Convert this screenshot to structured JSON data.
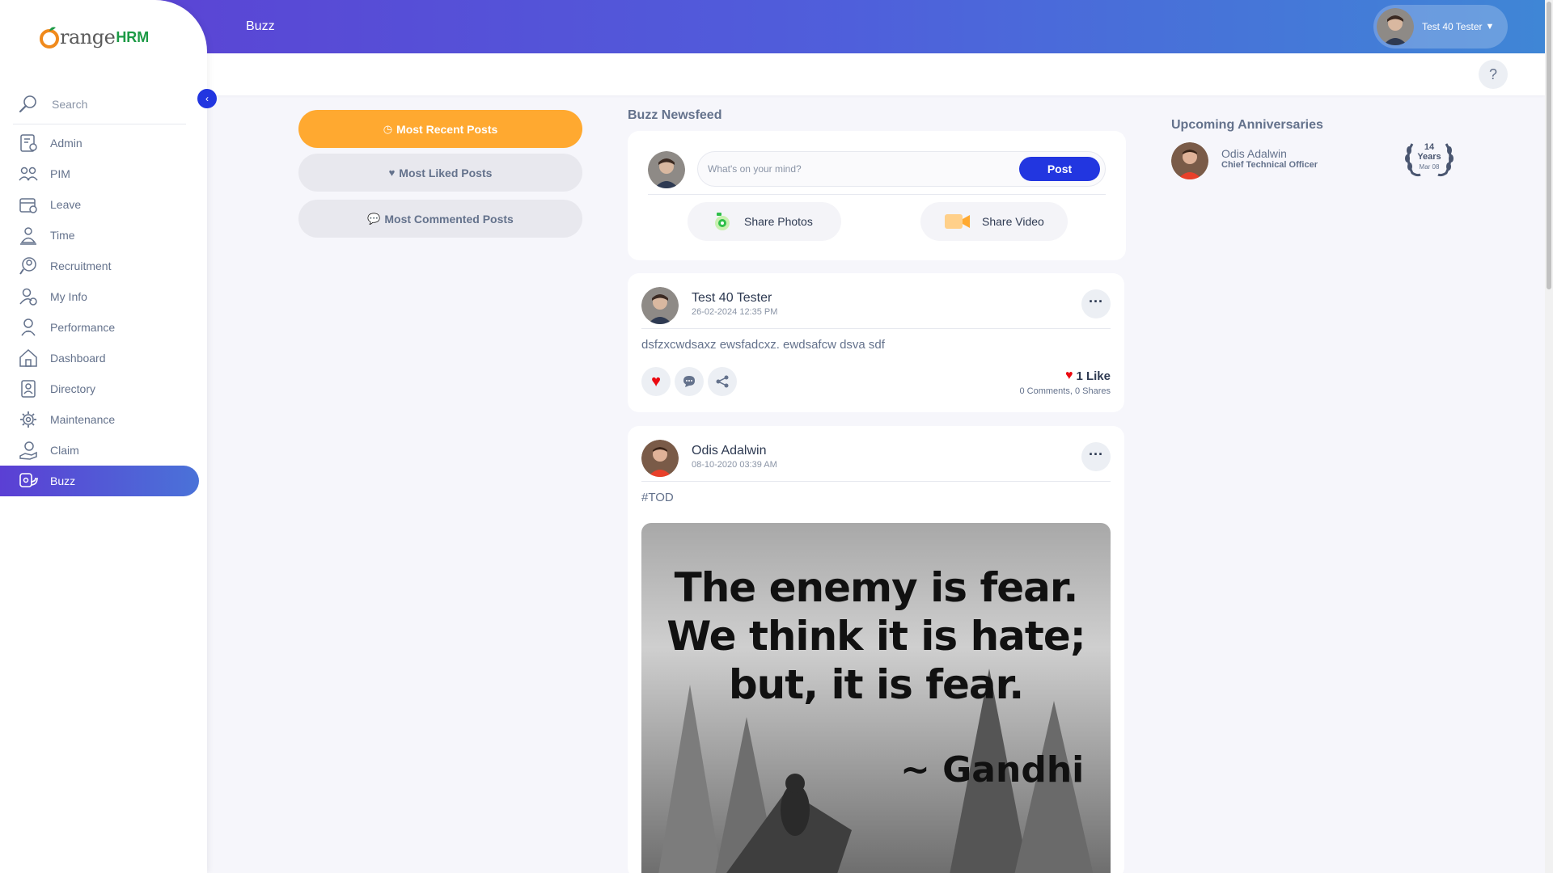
{
  "topbar": {
    "title": "Buzz",
    "user_name": "Test 40 Tester"
  },
  "help_label": "?",
  "sidebar": {
    "logo_word": "range",
    "logo_hrm": "HRM",
    "search_label": "Search",
    "items": [
      {
        "label": "Admin",
        "icon": "admin-icon"
      },
      {
        "label": "PIM",
        "icon": "pim-icon"
      },
      {
        "label": "Leave",
        "icon": "leave-icon"
      },
      {
        "label": "Time",
        "icon": "time-icon"
      },
      {
        "label": "Recruitment",
        "icon": "recruitment-icon"
      },
      {
        "label": "My Info",
        "icon": "my-info-icon"
      },
      {
        "label": "Performance",
        "icon": "performance-icon"
      },
      {
        "label": "Dashboard",
        "icon": "dashboard-icon"
      },
      {
        "label": "Directory",
        "icon": "directory-icon"
      },
      {
        "label": "Maintenance",
        "icon": "maintenance-icon"
      },
      {
        "label": "Claim",
        "icon": "claim-icon"
      },
      {
        "label": "Buzz",
        "icon": "buzz-icon",
        "active": true
      }
    ]
  },
  "filters": {
    "most_recent": "Most Recent Posts",
    "most_liked": "Most Liked Posts",
    "most_commented": "Most Commented Posts"
  },
  "feed": {
    "title": "Buzz Newsfeed",
    "composer": {
      "placeholder": "What's on your mind?",
      "post_label": "Post",
      "share_photos": "Share Photos",
      "share_video": "Share Video"
    },
    "posts": [
      {
        "author": "Test 40 Tester",
        "timestamp": "26-02-2024 12:35 PM",
        "body": "dsfzxcwdsaxz ewsfadcxz. ewdsafcw dsva sdf",
        "likes": "1 Like",
        "comments": "0 Comments",
        "shares": "0 Shares"
      },
      {
        "author": "Odis Adalwin",
        "timestamp": "08-10-2020 03:39 AM",
        "body": "#TOD",
        "image_quote_lines": [
          "The enemy is fear.",
          "We think it is hate;",
          "but, it is fear."
        ],
        "image_quote_author": "~ Gandhi"
      }
    ]
  },
  "anniversaries": {
    "title": "Upcoming Anniversaries",
    "items": [
      {
        "name": "Odis Adalwin",
        "job": "Chief Technical Officer",
        "years": "14",
        "years_label": "Years",
        "date": "Mar 08"
      }
    ]
  },
  "colors": {
    "accent_orange": "#ffa930",
    "accent_blue": "#2236e0",
    "like_red": "#eb0910"
  }
}
